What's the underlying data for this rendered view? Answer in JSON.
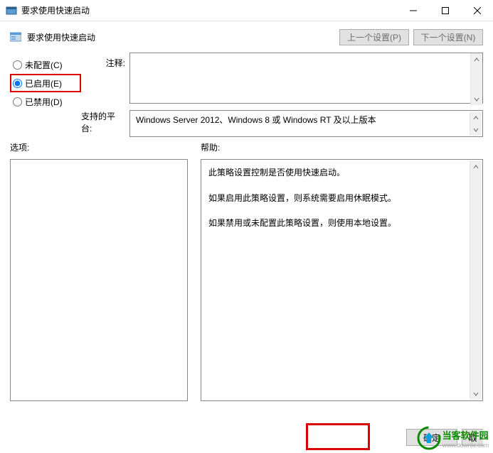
{
  "titlebar": {
    "title": "要求使用快速启动"
  },
  "header": {
    "title": "要求使用快速启动",
    "prev_btn": "上一个设置(P)",
    "next_btn": "下一个设置(N)"
  },
  "radios": {
    "not_configured": "未配置(C)",
    "enabled": "已启用(E)",
    "disabled": "已禁用(D)",
    "selected": "enabled"
  },
  "labels": {
    "comment": "注释:",
    "platform": "支持的平台:",
    "options": "选项:",
    "help": "帮助:"
  },
  "fields": {
    "comment_value": "",
    "platform_value": "Windows Server 2012、Windows 8 或 Windows RT 及以上版本"
  },
  "help_text": {
    "p1": "此策略设置控制是否使用快速启动。",
    "p2": "如果启用此策略设置，则系统需要启用休眠模式。",
    "p3": "如果禁用或未配置此策略设置，则使用本地设置。"
  },
  "footer": {
    "ok": "确定",
    "cancel": "取"
  },
  "watermark": {
    "name": "当客软件园",
    "url": "www.downkr.com"
  }
}
